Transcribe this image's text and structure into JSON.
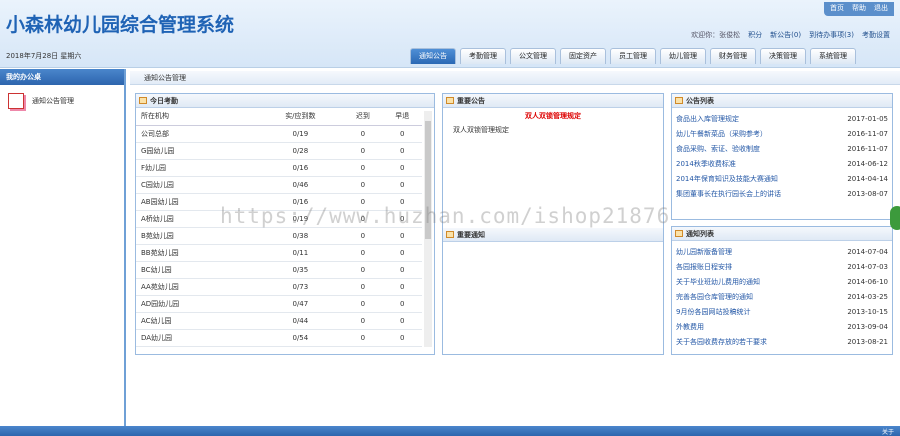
{
  "header": {
    "title": "小森林幼儿园综合管理系统",
    "top_links": [
      "首页",
      "帮助",
      "退出"
    ],
    "user_row": [
      "欢迎你：张俊松",
      "积分",
      "新公告(0)",
      "到待办事项(3)",
      "考勤设置"
    ],
    "date": "2018年7月28日 星期六"
  },
  "tabs": [
    "通知公告",
    "考勤管理",
    "公文管理",
    "固定资产",
    "员工管理",
    "幼儿管理",
    "财务管理",
    "决策管理",
    "系统管理"
  ],
  "sidebar": {
    "title": "我的办公桌",
    "item": "通知公告管理"
  },
  "breadcrumb": "通知公告管理",
  "attendance": {
    "title": "今日考勤",
    "headers": [
      "所在机构",
      "实/应到数",
      "迟到",
      "早退"
    ],
    "rows": [
      [
        "公司总部",
        "0/19",
        "0",
        "0"
      ],
      [
        "G园幼儿园",
        "0/28",
        "0",
        "0"
      ],
      [
        "F幼儿园",
        "0/16",
        "0",
        "0"
      ],
      [
        "C园幼儿园",
        "0/46",
        "0",
        "0"
      ],
      [
        "AB园幼儿园",
        "0/16",
        "0",
        "0"
      ],
      [
        "A桥幼儿园",
        "0/19",
        "0",
        "0"
      ],
      [
        "B苑幼儿园",
        "0/38",
        "0",
        "0"
      ],
      [
        "BB苑幼儿园",
        "0/11",
        "0",
        "0"
      ],
      [
        "BC幼儿园",
        "0/35",
        "0",
        "0"
      ],
      [
        "AA苑幼儿园",
        "0/73",
        "0",
        "0"
      ],
      [
        "AD园幼儿园",
        "0/47",
        "0",
        "0"
      ],
      [
        "AC幼儿园",
        "0/44",
        "0",
        "0"
      ],
      [
        "DA幼儿园",
        "0/54",
        "0",
        "0"
      ]
    ]
  },
  "important": {
    "title": "重要公告",
    "headline": "双人双锁管理规定",
    "text": "双人双锁管理规定",
    "notice_title": "重要通知"
  },
  "announcements": {
    "title": "公告列表",
    "items": [
      [
        "食品出入库管理规定",
        "2017-01-05"
      ],
      [
        "幼儿午餐新菜品（采购参考）",
        "2016-11-07"
      ],
      [
        "食品采购、索证、验收制度",
        "2016-11-07"
      ],
      [
        "2014秋季收费标准",
        "2014-06-12"
      ],
      [
        "2014年保育知识及技能大赛通知",
        "2014-04-14"
      ],
      [
        "集团董事长在执行园长会上的讲话",
        "2013-08-07"
      ]
    ]
  },
  "notices": {
    "title": "通知列表",
    "items": [
      [
        "幼儿园新版备管理",
        "2014-07-04"
      ],
      [
        "各园报账日程安排",
        "2014-07-03"
      ],
      [
        "关于毕业班幼儿费用的通知",
        "2014-06-10"
      ],
      [
        "完善各园仓库管理的通知",
        "2014-03-25"
      ],
      [
        "9月份各园网站投稿统计",
        "2013-10-15"
      ],
      [
        "外教费用",
        "2013-09-04"
      ],
      [
        "关于各园收费存放的若干要求",
        "2013-08-21"
      ]
    ]
  },
  "footer": "关于",
  "watermark": "https://www.huzhan.com/ishop21876"
}
